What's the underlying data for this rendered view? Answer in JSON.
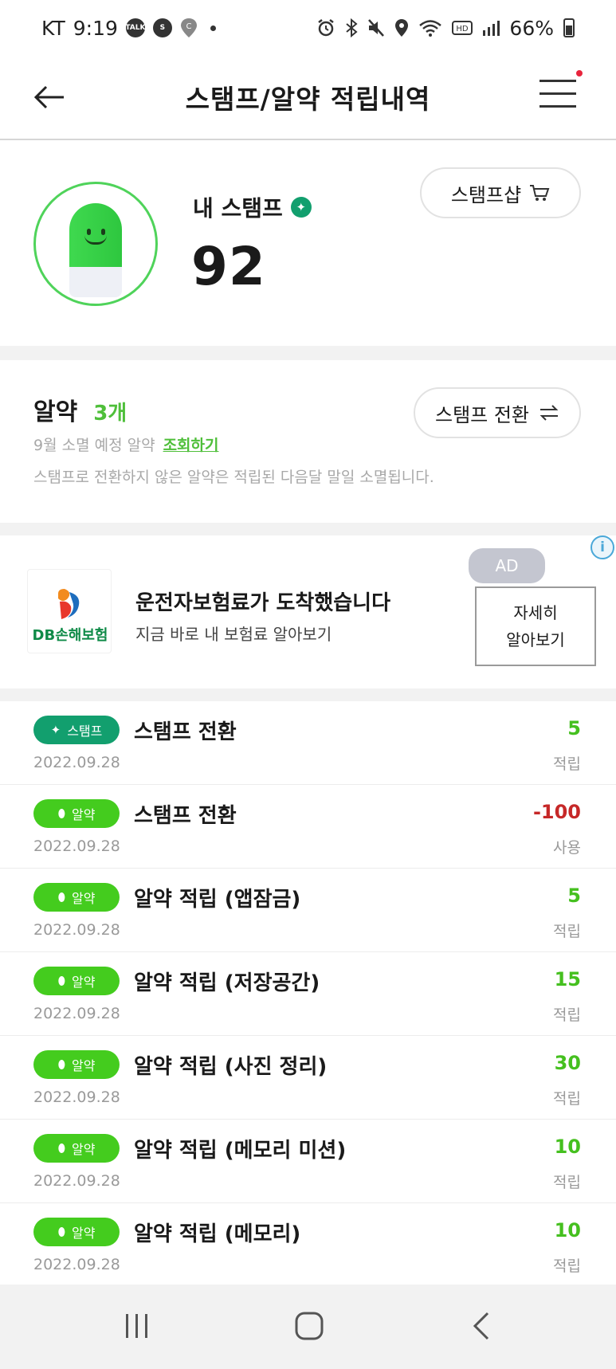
{
  "status_bar": {
    "carrier": "KT",
    "time": "9:19",
    "battery": "66%"
  },
  "header": {
    "title": "스탬프/알약 적립내역"
  },
  "stamp": {
    "label": "내 스탬프",
    "count": "92",
    "shop_label": "스탬프샵"
  },
  "pill": {
    "title": "알약",
    "count": "3개",
    "expire_text": "9월 소멸 예정 알약",
    "expire_link": "조회하기",
    "notice": "스탬프로 전환하지 않은 알약은 적립된 다음달 말일 소멸됩니다.",
    "convert_label": "스탬프 전환"
  },
  "ad": {
    "badge": "AD",
    "brand": "DB손해보험",
    "headline": "운전자보험료가 도착했습니다",
    "sub": "지금 바로 내 보험료 알아보기",
    "cta_line1": "자세히",
    "cta_line2": "알아보기"
  },
  "history": [
    {
      "type": "stamp",
      "badge": "스탬프",
      "title": "스탬프 전환",
      "date": "2022.09.28",
      "amount": "5",
      "status": "적립"
    },
    {
      "type": "pill",
      "badge": "알약",
      "title": "스탬프 전환",
      "date": "2022.09.28",
      "amount": "-100",
      "status": "사용"
    },
    {
      "type": "pill",
      "badge": "알약",
      "title": "알약 적립 (앱잠금)",
      "date": "2022.09.28",
      "amount": "5",
      "status": "적립"
    },
    {
      "type": "pill",
      "badge": "알약",
      "title": "알약 적립 (저장공간)",
      "date": "2022.09.28",
      "amount": "15",
      "status": "적립"
    },
    {
      "type": "pill",
      "badge": "알약",
      "title": "알약 적립 (사진 정리)",
      "date": "2022.09.28",
      "amount": "30",
      "status": "적립"
    },
    {
      "type": "pill",
      "badge": "알약",
      "title": "알약 적립 (메모리 미션)",
      "date": "2022.09.28",
      "amount": "10",
      "status": "적립"
    },
    {
      "type": "pill",
      "badge": "알약",
      "title": "알약 적립 (메모리)",
      "date": "2022.09.28",
      "amount": "10",
      "status": "적립"
    }
  ],
  "colors": {
    "accent_green": "#44cc1e",
    "stamp_green": "#129f6e",
    "negative_red": "#c62828"
  }
}
